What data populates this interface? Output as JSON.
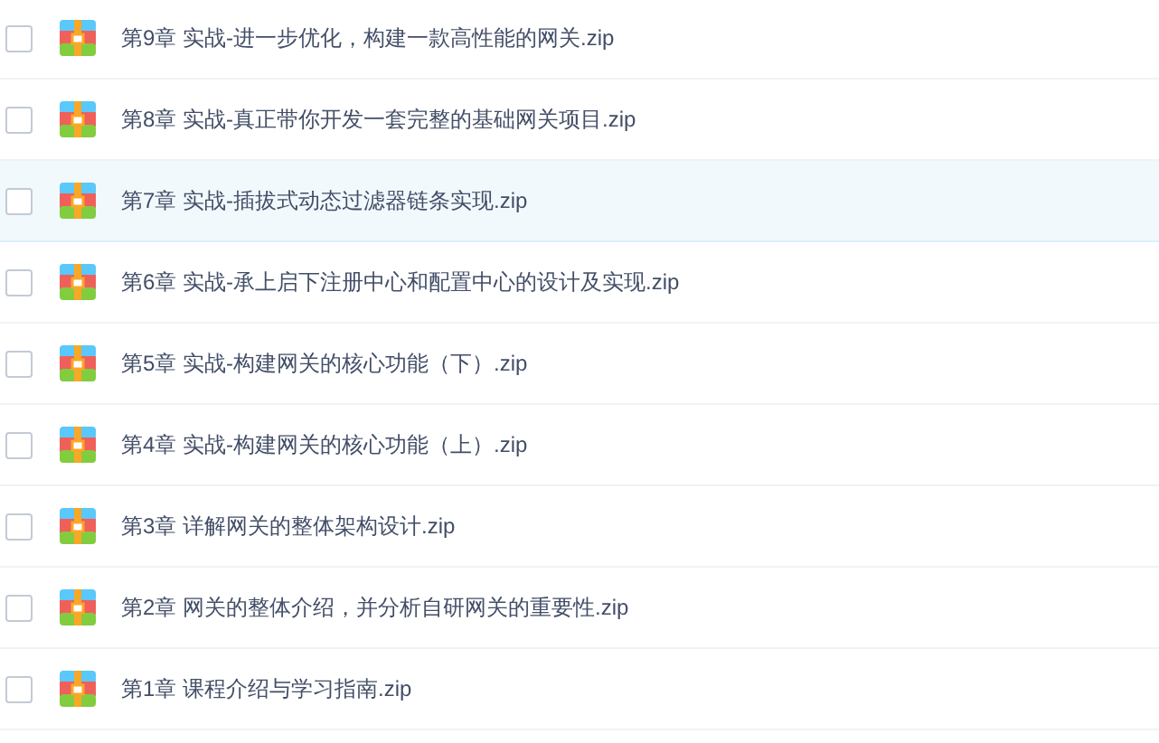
{
  "files": [
    {
      "name": "第9章 实战-进一步优化，构建一款高性能的网关.zip",
      "checked": false,
      "selected": false
    },
    {
      "name": "第8章 实战-真正带你开发一套完整的基础网关项目.zip",
      "checked": false,
      "selected": false
    },
    {
      "name": "第7章 实战-插拔式动态过滤器链条实现.zip",
      "checked": false,
      "selected": true
    },
    {
      "name": "第6章 实战-承上启下注册中心和配置中心的设计及实现.zip",
      "checked": false,
      "selected": false
    },
    {
      "name": "第5章 实战-构建网关的核心功能（下）.zip",
      "checked": false,
      "selected": false
    },
    {
      "name": "第4章 实战-构建网关的核心功能（上）.zip",
      "checked": false,
      "selected": false
    },
    {
      "name": "第3章 详解网关的整体架构设计.zip",
      "checked": false,
      "selected": false
    },
    {
      "name": "第2章 网关的整体介绍，并分析自研网关的重要性.zip",
      "checked": false,
      "selected": false
    },
    {
      "name": "第1章 课程介绍与学习指南.zip",
      "checked": false,
      "selected": false
    }
  ]
}
